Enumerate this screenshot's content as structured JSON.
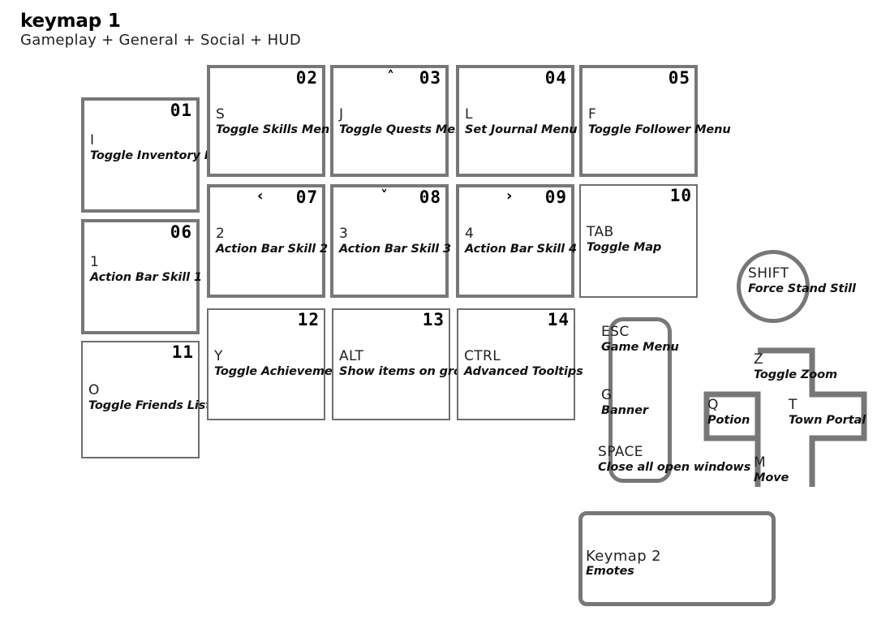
{
  "header": {
    "title": "keymap 1",
    "subtitle": "Gameplay + General + Social + HUD"
  },
  "colors": {
    "border_thick": "#777777",
    "border_thin": "#6f6f6f",
    "text": "#111111",
    "background": "#ffffff"
  },
  "keys": [
    {
      "badge": "01",
      "cap": "I",
      "desc": "Toggle Inventory Menu",
      "arrow": "",
      "border": "thick"
    },
    {
      "badge": "02",
      "cap": "S",
      "desc": "Toggle Skills Menu",
      "arrow": "",
      "border": "thick"
    },
    {
      "badge": "03",
      "cap": "J",
      "desc": "Toggle Quests Menu",
      "arrow": "^",
      "border": "thick"
    },
    {
      "badge": "04",
      "cap": "L",
      "desc": "Set Journal Menu",
      "arrow": "",
      "border": "thick"
    },
    {
      "badge": "05",
      "cap": "F",
      "desc": "Toggle Follower Menu",
      "arrow": "",
      "border": "thick"
    },
    {
      "badge": "06",
      "cap": "1",
      "desc": "Action Bar Skill 1",
      "arrow": "",
      "border": "thick"
    },
    {
      "badge": "07",
      "cap": "2",
      "desc": "Action Bar Skill 2",
      "arrow": "<",
      "border": "thick"
    },
    {
      "badge": "08",
      "cap": "3",
      "desc": "Action Bar Skill 3",
      "arrow": "v",
      "border": "thick"
    },
    {
      "badge": "09",
      "cap": "4",
      "desc": "Action Bar Skill 4",
      "arrow": ">",
      "border": "thick"
    },
    {
      "badge": "10",
      "cap": "TAB",
      "desc": "Toggle Map",
      "arrow": "",
      "border": "thin"
    },
    {
      "badge": "11",
      "cap": "O",
      "desc": "Toggle Friends List",
      "arrow": "",
      "border": "thin"
    },
    {
      "badge": "12",
      "cap": "Y",
      "desc": "Toggle Achievements",
      "arrow": "",
      "border": "thin"
    },
    {
      "badge": "13",
      "cap": "ALT",
      "desc": "Show items on ground",
      "arrow": "",
      "border": "thin"
    },
    {
      "badge": "14",
      "cap": "CTRL",
      "desc": "Advanced Tooltips",
      "arrow": "",
      "border": "thin"
    }
  ],
  "pill": {
    "entries": [
      {
        "cap": "ESC",
        "desc": "Game Menu"
      },
      {
        "cap": "G",
        "desc": "Banner"
      },
      {
        "cap": "SPACE",
        "desc": "Close all open windows"
      }
    ]
  },
  "circle": {
    "cap": "SHIFT",
    "desc": "Force Stand Still"
  },
  "cross": {
    "entries": [
      {
        "cap": "Z",
        "desc": "Toggle Zoom"
      },
      {
        "cap": "Q",
        "desc": "Potion"
      },
      {
        "cap": "T",
        "desc": "Town Portal"
      },
      {
        "cap": "M",
        "desc": "Move"
      }
    ]
  },
  "keymap2": {
    "cap": "Keymap 2",
    "desc": "Emotes"
  }
}
